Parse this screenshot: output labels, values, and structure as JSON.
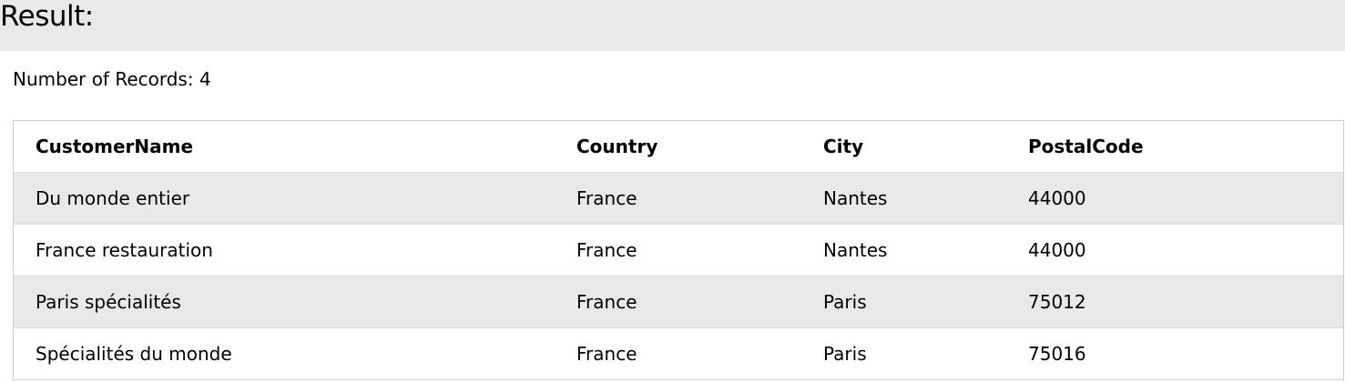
{
  "header": {
    "title": "Result:"
  },
  "summary": {
    "record_count_text": "Number of Records: 4"
  },
  "table": {
    "columns": [
      "CustomerName",
      "Country",
      "City",
      "PostalCode"
    ],
    "rows": [
      [
        "Du monde entier",
        "France",
        "Nantes",
        "44000"
      ],
      [
        "France restauration",
        "France",
        "Nantes",
        "44000"
      ],
      [
        "Paris spécialités",
        "France",
        "Paris",
        "75012"
      ],
      [
        "Spécialités du monde",
        "France",
        "Paris",
        "75016"
      ]
    ]
  },
  "colors": {
    "header_bg": "#e7e9eb",
    "stripe_bg": "#e7e9eb",
    "border": "#cccccc"
  }
}
